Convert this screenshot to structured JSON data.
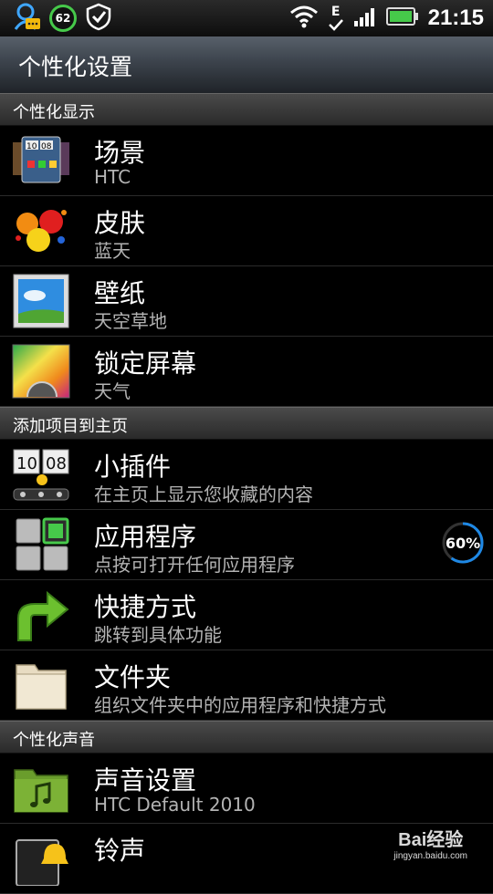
{
  "status_bar": {
    "notification_count": "62",
    "network_type": "E",
    "time": "21:15"
  },
  "header": {
    "title": "个性化设置"
  },
  "sections": [
    {
      "header": "个性化显示",
      "items": [
        {
          "title": "场景",
          "subtitle": "HTC",
          "icon": "scene-icon"
        },
        {
          "title": "皮肤",
          "subtitle": "蓝天",
          "icon": "skin-icon"
        },
        {
          "title": "壁纸",
          "subtitle": "天空草地",
          "icon": "wallpaper-icon"
        },
        {
          "title": "锁定屏幕",
          "subtitle": "天气",
          "icon": "lockscreen-icon"
        }
      ]
    },
    {
      "header": "添加项目到主页",
      "items": [
        {
          "title": "小插件",
          "subtitle": "在主页上显示您收藏的内容",
          "icon": "widget-icon"
        },
        {
          "title": "应用程序",
          "subtitle": "点按可打开任何应用程序",
          "icon": "apps-icon"
        },
        {
          "title": "快捷方式",
          "subtitle": "跳转到具体功能",
          "icon": "shortcut-arrow-icon"
        },
        {
          "title": "文件夹",
          "subtitle": "组织文件夹中的应用程序和快捷方式",
          "icon": "folder-icon"
        }
      ]
    },
    {
      "header": "个性化声音",
      "items": [
        {
          "title": "声音设置",
          "subtitle": "HTC Default 2010",
          "icon": "sound-folder-icon"
        },
        {
          "title": "铃声",
          "subtitle": "",
          "icon": "ringtone-icon"
        }
      ]
    }
  ],
  "overlay": {
    "progress_label": "60%",
    "progress_value": 0.6,
    "watermark_text": "Bai经验",
    "watermark_url": "jingyan.baidu.com"
  },
  "colors": {
    "accent_blue": "#1e88e5",
    "signal_green": "#46c94a"
  }
}
